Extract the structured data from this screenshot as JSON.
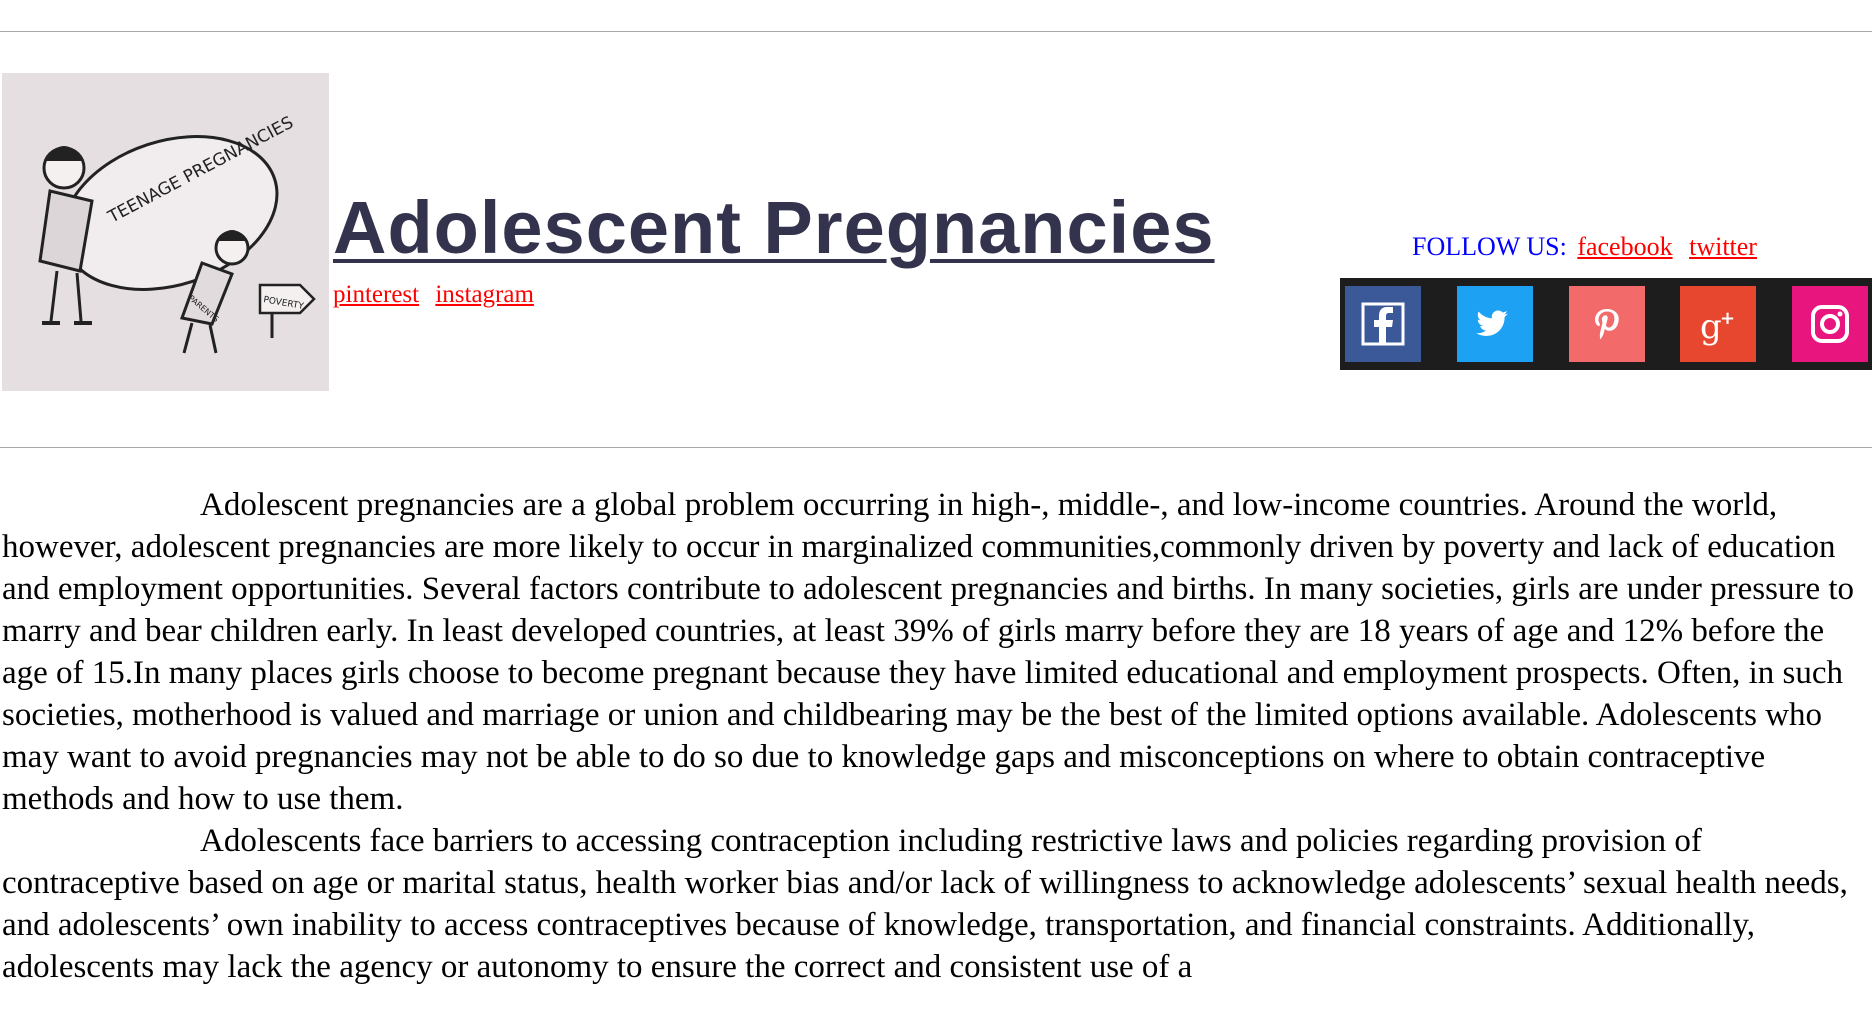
{
  "header": {
    "title": "Adolescent Pregnancies",
    "image_text": {
      "main": "TEENAGE PREGNANCIES",
      "child_label": "PARENTS",
      "sign_label": "POVERTY"
    },
    "links": [
      {
        "label": "pinterest"
      },
      {
        "label": "instagram"
      }
    ]
  },
  "follow": {
    "label": "FOLLOW US:",
    "links": [
      {
        "label": "facebook"
      },
      {
        "label": "twitter"
      }
    ]
  },
  "social_icons": [
    {
      "name": "facebook-icon",
      "color": "#3b5998"
    },
    {
      "name": "twitter-icon",
      "color": "#1da1f2"
    },
    {
      "name": "pinterest-icon",
      "color": "#f26a6a"
    },
    {
      "name": "google-plus-icon",
      "color": "#e8472f"
    },
    {
      "name": "instagram-icon",
      "color": "#e8157e"
    }
  ],
  "colors": {
    "title": "#33334d",
    "link": "#ff0000",
    "follow_label": "#0000ff",
    "social_bar": "#1d1d1d"
  },
  "article": {
    "paragraphs": [
      "Adolescent pregnancies are a global problem occurring in high-, middle-, and low-income countries. Around the world, however, adolescent pregnancies are more likely to occur in marginalized communities,commonly driven by poverty and lack of education and employment opportunities. Several factors contribute to adolescent pregnancies and births. In many societies, girls are under pressure to marry and bear children early. In least developed countries, at least 39% of girls marry before they are 18 years of age and 12% before the age of 15.In many places girls choose to become pregnant because they have limited educational and employment prospects. Often, in such societies, motherhood is valued and marriage or union and childbearing may be the best of the limited options available. Adolescents who may want to avoid pregnancies may not be able to do so due to knowledge gaps and misconceptions on where to obtain contraceptive methods and how to use them.",
      "Adolescents face barriers to accessing contraception including restrictive laws and policies regarding provision of contraceptive based on age or marital status, health worker bias and/or lack of willingness to acknowledge adolescents’ sexual health needs, and adolescents’ own inability to access contraceptives because of knowledge, transportation, and financial constraints. Additionally, adolescents may lack the agency or autonomy to ensure the correct and consistent use of a"
    ]
  }
}
